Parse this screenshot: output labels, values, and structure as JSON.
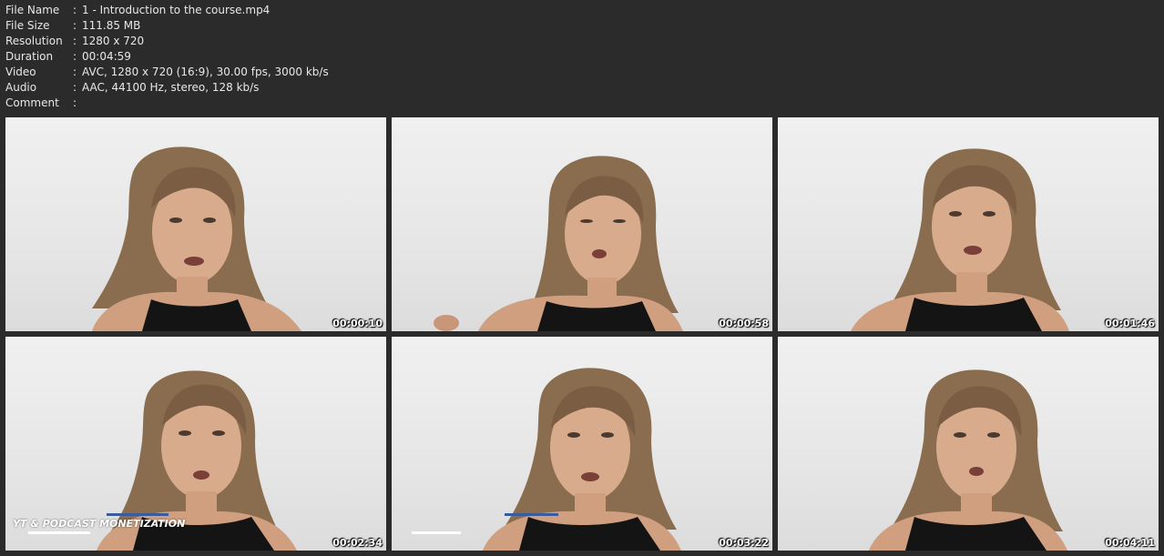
{
  "info": {
    "rows": [
      {
        "label": "File Name",
        "value": "1 - Introduction to the course.mp4"
      },
      {
        "label": "File Size",
        "value": "111.85 MB"
      },
      {
        "label": "Resolution",
        "value": "1280 x 720"
      },
      {
        "label": "Duration",
        "value": "00:04:59"
      },
      {
        "label": "Video",
        "value": "AVC, 1280 x 720 (16:9), 30.00 fps, 3000 kb/s"
      },
      {
        "label": "Audio",
        "value": "AAC, 44100 Hz, stereo, 128 kb/s"
      },
      {
        "label": "Comment",
        "value": ""
      }
    ],
    "separator": ":"
  },
  "thumbnails": [
    {
      "timestamp": "00:00:10"
    },
    {
      "timestamp": "00:00:58"
    },
    {
      "timestamp": "00:01:46"
    },
    {
      "timestamp": "00:02:34",
      "overlay": "YT & PODCAST MONETIZATION"
    },
    {
      "timestamp": "00:03:22"
    },
    {
      "timestamp": "00:04:11"
    }
  ],
  "colors": {
    "background": "#2b2b2b",
    "accent_bar": "#3b5c9a",
    "top_dress": "#111111"
  }
}
